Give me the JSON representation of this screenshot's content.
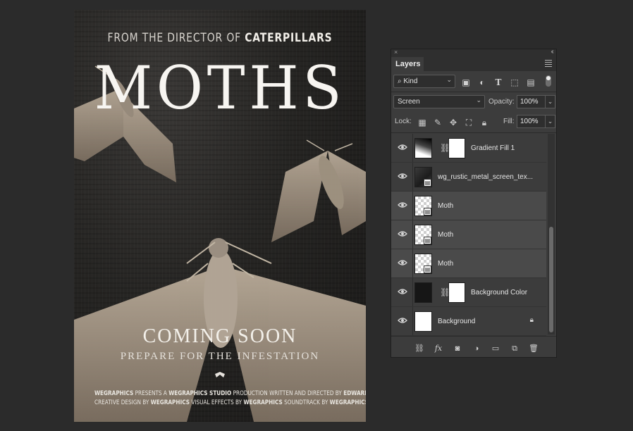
{
  "poster": {
    "tagline_pre": "FROM THE DIRECTOR OF",
    "tagline_bold": "CATERPILLARS",
    "title": "MOTHS",
    "coming": "COMING SOON",
    "prepare": "PREPARE FOR THE INFESTATION",
    "credits_line1_a": "WEGRAPHICS",
    "credits_line1_b": " PRESENTS A ",
    "credits_line1_c": "WEGRAPHICS STUDIO",
    "credits_line1_d": " PRODUCTION WRITTEN AND DIRECTED BY ",
    "credits_line1_e": "EDWARD DUST",
    "credits_line2_a": "CREATIVE DESIGN BY ",
    "credits_line2_b": "WEGRAPHICS",
    "credits_line2_c": " VISUAL EFFECTS BY ",
    "credits_line2_d": "WEGRAPHICS",
    "credits_line2_e": " SOUNDTRACK BY ",
    "credits_line2_f": "WEGRAPHICS"
  },
  "panel": {
    "close_glyph": "×",
    "collapse_glyph": "‹‹",
    "tab_label": "Layers",
    "filter_kind": "Kind",
    "blend_mode": "Screen",
    "opacity_label": "Opacity:",
    "opacity_value": "100%",
    "lock_label": "Lock:",
    "fill_label": "Fill:",
    "fill_value": "100%",
    "layers": [
      {
        "name": "Gradient Fill 1",
        "thumb": "gradient",
        "mask": true,
        "selected": false
      },
      {
        "name": "wg_rustic_metal_screen_tex...",
        "thumb": "texture",
        "mask": false,
        "selected": false
      },
      {
        "name": "Moth",
        "thumb": "checker",
        "mask": false,
        "selected": true
      },
      {
        "name": "Moth",
        "thumb": "checker",
        "mask": false,
        "selected": true
      },
      {
        "name": "Moth",
        "thumb": "checker",
        "mask": false,
        "selected": true
      },
      {
        "name": "Background Color",
        "thumb": "dark",
        "mask": true,
        "selected": false
      },
      {
        "name": "Background",
        "thumb": "white",
        "mask": false,
        "selected": false,
        "locked": true
      }
    ]
  },
  "icons": {
    "filter": [
      "image-filter-icon",
      "adjustment-filter-icon",
      "type-filter-icon",
      "shape-filter-icon",
      "smart-object-filter-icon"
    ],
    "lock": [
      "lock-transparent-icon",
      "lock-paint-icon",
      "lock-position-icon",
      "lock-artboard-icon",
      "lock-all-icon"
    ],
    "footer": [
      "link-layers-icon",
      "fx-icon",
      "add-mask-icon",
      "new-adjustment-icon",
      "new-group-icon",
      "new-layer-icon",
      "delete-layer-icon"
    ]
  }
}
